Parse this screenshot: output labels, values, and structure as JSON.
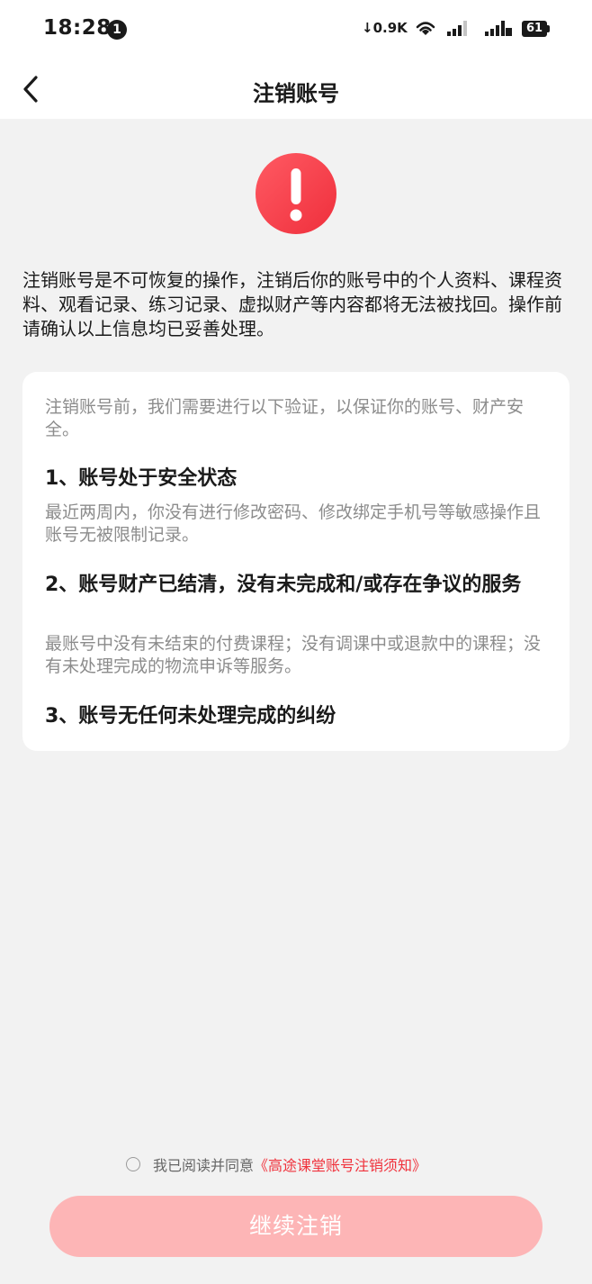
{
  "status_bar": {
    "time": "18:28",
    "notification_count": "1",
    "net_speed": "↓0.9K",
    "battery": "61"
  },
  "header": {
    "title": "注销账号",
    "back_icon": "chevron-left-icon"
  },
  "warning": {
    "icon": "exclamation-icon",
    "color": "#f23b47"
  },
  "intro": "注销账号是不可恢复的操作，注销后你的账号中的个人资料、课程资料、观看记录、练习记录、虚拟财产等内容都将无法被找回。操作前请确认以上信息均已妥善处理。",
  "card": {
    "intro": "注销账号前，我们需要进行以下验证，以保证你的账号、财产安全。",
    "items": [
      {
        "title": "1、账号处于安全状态",
        "desc": "最近两周内，你没有进行修改密码、修改绑定手机号等敏感操作且账号无被限制记录。"
      },
      {
        "title": "2、账号财产已结清，没有未完成和/或存在争议的服务",
        "desc": "最账号中没有未结束的付费课程；没有调课中或退款中的课程；没有未处理完成的物流申诉等服务。"
      },
      {
        "title": "3、账号无任何未处理完成的纠纷",
        "desc": ""
      }
    ]
  },
  "agreement": {
    "checked": false,
    "text": "我已阅读并同意",
    "link": "《高途课堂账号注销须知》",
    "link_color": "#f0323c"
  },
  "continue_button": {
    "label": "继续注销",
    "color": "#fdb5b6",
    "enabled": false
  }
}
